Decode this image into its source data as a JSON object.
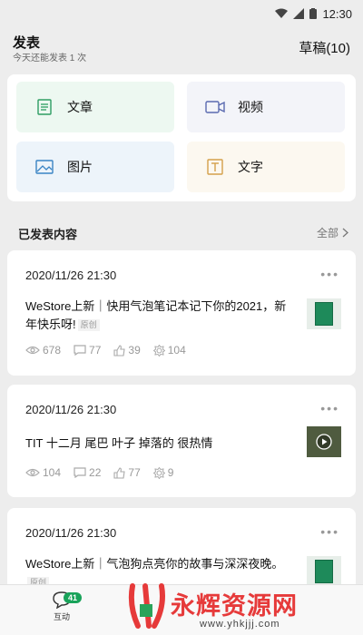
{
  "status_bar": {
    "time": "12:30"
  },
  "header": {
    "title": "发表",
    "subtitle": "今天还能发表 1 次",
    "drafts": "草稿(10)"
  },
  "publish_options": [
    {
      "label": "文章",
      "icon": "article-icon"
    },
    {
      "label": "视频",
      "icon": "video-icon"
    },
    {
      "label": "图片",
      "icon": "image-icon"
    },
    {
      "label": "文字",
      "icon": "text-icon"
    }
  ],
  "published": {
    "section_label": "已发表内容",
    "all_label": "全部"
  },
  "posts": [
    {
      "date": "2020/11/26 21:30",
      "content": "WeStore上新｜快用气泡笔记本记下你的2021，新年快乐呀!",
      "tag": "原创",
      "views": "678",
      "comments": "77",
      "likes": "39",
      "shares": "104",
      "thumb": "notebook-thumbnail"
    },
    {
      "date": "2020/11/26 21:30",
      "content": "TIT 十二月 尾巴 叶子 掉落的 很热情",
      "tag": "",
      "views": "104",
      "comments": "22",
      "likes": "77",
      "shares": "9",
      "thumb": "video-thumbnail"
    },
    {
      "date": "2020/11/26 21:30",
      "content": "WeStore上新｜气泡狗点亮你的故事与深深夜晚。",
      "tag": "原创",
      "thumb": "notebook-thumbnail"
    }
  ],
  "tabbar": {
    "interact_label": "互动",
    "badge": "41"
  },
  "watermark": {
    "text": "永辉资源网",
    "url": "www.yhkjjj.com"
  },
  "colors": {
    "accent": "#19a35a",
    "watermark_red": "#e63a3a"
  }
}
